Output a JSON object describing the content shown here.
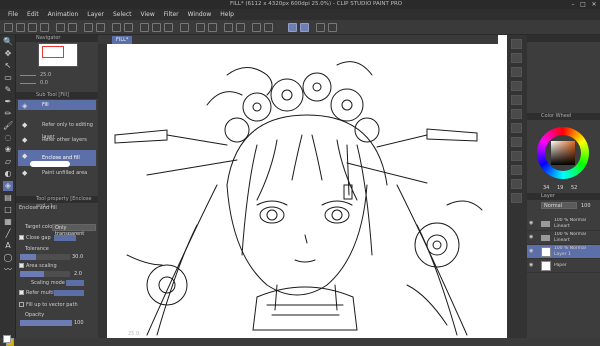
{
  "window": {
    "title": "FILL* (6112 x 4320px 600dpi 25.0%)  - CLIP STUDIO PAINT PRO",
    "minimize": "–",
    "maximize": "□",
    "close": "✕"
  },
  "menubar": {
    "items": [
      "File",
      "Edit",
      "Animation",
      "Layer",
      "Select",
      "View",
      "Filter",
      "Window",
      "Help"
    ]
  },
  "document_tab": {
    "label": "FILL*"
  },
  "navigator": {
    "title": "Navigator",
    "zoom_value": "25.0",
    "angle_value": "0.0"
  },
  "sub_tool": {
    "title": "Sub Tool [Fill]",
    "group_label": "Fill",
    "items": [
      "Refer only to editing layer",
      "Refer other layers",
      "Enclose and fill",
      "Paint unfilled area"
    ]
  },
  "tool_property": {
    "title": "Tool property [Enclose and...]",
    "tool_name": "Enclose and fill",
    "target_color_label": "Target color",
    "target_color_value": "Only transparent",
    "close_gap_label": "Close gap",
    "tolerance_label": "Tolerance",
    "tolerance_value": "30.0",
    "area_scaling_label": "Area scaling",
    "area_scaling_value": "2.0",
    "scaling_mode_label": "Scaling mode",
    "refer_multiple_label": "Refer multiple",
    "fill_vector_label": "Fill up to vector path",
    "opacity_label": "Opacity",
    "opacity_value": "100"
  },
  "color_wheel": {
    "title": "Color Wheel",
    "h_value": "34",
    "s_value": "19",
    "v_value": "52"
  },
  "layer_panel": {
    "title": "Layer",
    "blend_mode": "Normal",
    "opacity_value": "100",
    "layers": [
      {
        "name_line1": "100 % Normal",
        "name_line2": "Lineart",
        "type": "folder"
      },
      {
        "name_line1": "100 % Normal",
        "name_line2": "Lineart",
        "type": "folder"
      },
      {
        "name_line1": "100 % Normal",
        "name_line2": "Layer 1",
        "type": "raster",
        "selected": true
      },
      {
        "name_line1": "Paper",
        "name_line2": "",
        "type": "paper"
      }
    ]
  },
  "status": {
    "zoom": "25.0"
  }
}
